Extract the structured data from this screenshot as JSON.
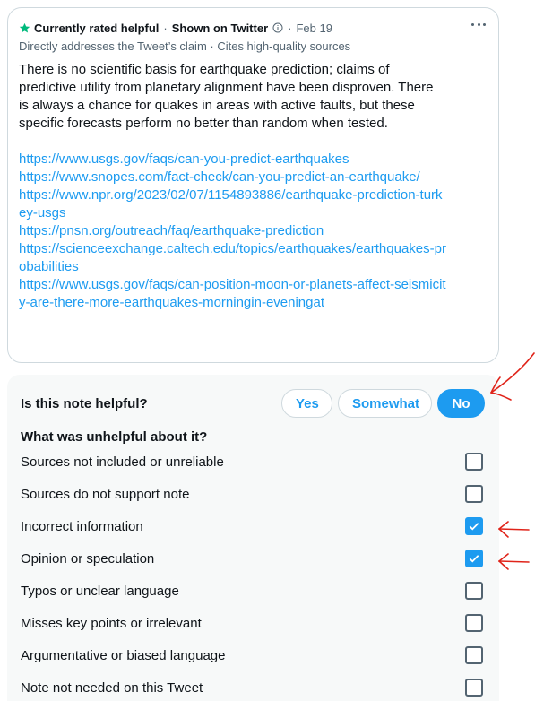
{
  "note": {
    "status": "Currently rated helpful",
    "shown_on": "Shown on Twitter",
    "separator": "·",
    "date": "Feb 19",
    "reasons": "Directly addresses the Tweet’s claim · Cites high-quality sources",
    "text": "There is no scientific basis for earthquake prediction; claims of predictive utility from planetary alignment have been disproven. There is always a chance for quakes in areas with active faults, but these specific forecasts perform no better than random when tested.",
    "links": [
      "https://www.usgs.gov/faqs/can-you-predict-earthquakes",
      "https://www.snopes.com/fact-check/can-you-predict-an-earthquake/",
      "https://www.npr.org/2023/02/07/1154893886/earthquake-prediction-turkey-usgs",
      "https://pnsn.org/outreach/faq/earthquake-prediction",
      "https://scienceexchange.caltech.edu/topics/earthquakes/earthquakes-probabilities",
      "https://www.usgs.gov/faqs/can-position-moon-or-planets-affect-seismicity-are-there-more-earthquakes-morningin-eveningat"
    ]
  },
  "rating": {
    "question": "Is this note helpful?",
    "buttons": {
      "yes": "Yes",
      "somewhat": "Somewhat",
      "no": "No"
    },
    "selected": "no",
    "unhelpful_title": "What was unhelpful about it?",
    "options": [
      {
        "label": "Sources not included or unreliable",
        "checked": false
      },
      {
        "label": "Sources do not support note",
        "checked": false
      },
      {
        "label": "Incorrect information",
        "checked": true
      },
      {
        "label": "Opinion or speculation",
        "checked": true
      },
      {
        "label": "Typos or unclear language",
        "checked": false
      },
      {
        "label": "Misses key points or irrelevant",
        "checked": false
      },
      {
        "label": "Argumentative or biased language",
        "checked": false
      },
      {
        "label": "Note not needed on this Tweet",
        "checked": false
      }
    ]
  },
  "colors": {
    "accent": "#1d9bf0",
    "star": "#00ba7c",
    "annotation": "#e0241a"
  }
}
